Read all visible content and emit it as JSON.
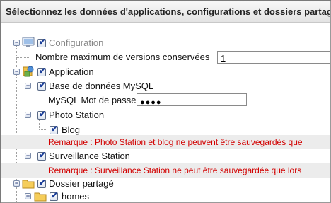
{
  "header": {
    "title": "Sélectionnez les données d'applications, configurations et dossiers partagés"
  },
  "tree": {
    "configuration": {
      "label": "Configuration",
      "max_versions_label": "Nombre maximum de versions conservées",
      "max_versions_value": "1"
    },
    "application": {
      "label": "Application",
      "mysql": {
        "label": "Base de données MySQL",
        "password_label": "MySQL Mot de passe",
        "password_value": "●●●●"
      },
      "photo_station": {
        "label": "Photo Station",
        "blog_label": "Blog",
        "remark": "Remarque : Photo Station et blog ne peuvent être sauvegardés que"
      },
      "surveillance_station": {
        "label": "Surveillance Station",
        "remark": "Remarque : Surveillance Station ne peut être sauvegardée que lors"
      }
    },
    "shared_folder": {
      "label": "Dossier partagé",
      "homes_label": "homes"
    },
    "toggles": {
      "expanded": "−",
      "collapsed": "+"
    },
    "check_mark": "✔"
  }
}
